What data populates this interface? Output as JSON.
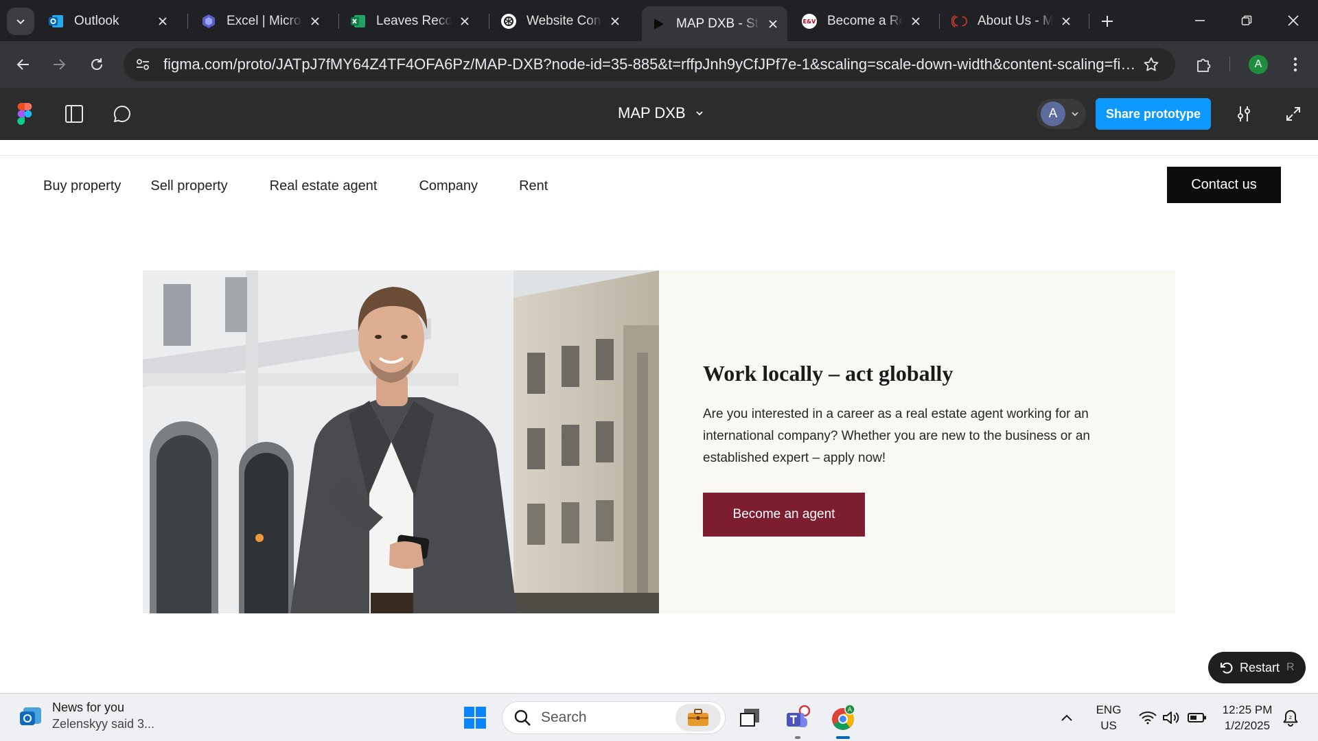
{
  "browser": {
    "tabs": [
      {
        "title": "Outlook",
        "favicon": "outlook-icon",
        "active": false
      },
      {
        "title": "Excel | Microsoft",
        "favicon": "copilot-icon",
        "active": false
      },
      {
        "title": "Leaves Record",
        "favicon": "excel-icon",
        "active": false
      },
      {
        "title": "Website Content",
        "favicon": "chatgpt-icon",
        "active": false
      },
      {
        "title": "MAP DXB - St",
        "favicon": "figma-play-icon",
        "active": true
      },
      {
        "title": "Become a Real",
        "favicon": "ev-icon",
        "active": false
      },
      {
        "title": "About Us - M",
        "favicon": "map-logo-icon",
        "active": false
      }
    ],
    "url": "figma.com/proto/JATpJ7fMY64Z4TF4OFA6Pz/MAP-DXB?node-id=35-885&t=rffpJnh9yCfJPf7e-1&scaling=scale-down-width&content-scaling=fixed&p...",
    "profile_initial": "A"
  },
  "figma": {
    "file_name": "MAP DXB",
    "user_initial": "A",
    "share_label": "Share prototype"
  },
  "site": {
    "nav": [
      "Buy property",
      "Sell property",
      "Real estate agent",
      "Company",
      "Rent"
    ],
    "contact_label": "Contact us",
    "hero": {
      "title": "Work locally – act globally",
      "text": "Are you interested in a career as a real estate agent working for an international company? Whether you are new to the business or an established expert – apply now!",
      "cta": "Become an agent"
    },
    "restart_label": "Restart",
    "restart_key": "R"
  },
  "taskbar": {
    "news_title": "News for you",
    "news_sub": "Zelenskyy said 3...",
    "search_label": "Search",
    "lang_line1": "ENG",
    "lang_line2": "US",
    "time": "12:25 PM",
    "date": "1/2/2025"
  },
  "colors": {
    "figma_blue": "#0d99ff",
    "cta_maroon": "#7d1d30",
    "panel_cream": "#faf8f3"
  }
}
